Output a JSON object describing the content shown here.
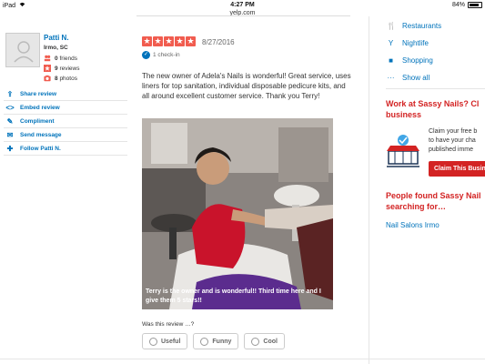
{
  "status_bar": {
    "device": "iPad",
    "time": "4:27 PM",
    "url": "yelp.com",
    "battery": "84%",
    "battery_level": 0.84
  },
  "user": {
    "name": "Patti N.",
    "location": "Irmo, SC",
    "friends": "0",
    "friends_label": "friends",
    "reviews": "9",
    "reviews_label": "reviews",
    "photos": "8",
    "photos_label": "photos"
  },
  "actions": [
    {
      "label": "Share review",
      "icon": "share-icon"
    },
    {
      "label": "Embed review",
      "icon": "code-icon"
    },
    {
      "label": "Compliment",
      "icon": "compliment-icon"
    },
    {
      "label": "Send message",
      "icon": "message-icon"
    },
    {
      "label": "Follow Patti N.",
      "icon": "follow-icon"
    }
  ],
  "review": {
    "rating": 5,
    "date": "8/27/2016",
    "checkin": "1 check-in",
    "text": "The new owner of Adela's Nails is wonderful! Great service, uses liners for top sanitation, individual disposable pedicure kits, and all around excellent customer service. Thank you Terry!",
    "photo_caption": "Terry is the owner and is wonderful!! Third time here and I give them 5 stars!!",
    "was_this": "Was this review …?",
    "votes": [
      {
        "label": "Useful",
        "icon": "useful-icon"
      },
      {
        "label": "Funny",
        "icon": "funny-icon"
      },
      {
        "label": "Cool",
        "icon": "cool-icon"
      }
    ]
  },
  "sidebar": {
    "links": [
      {
        "label": "Restaurants",
        "icon": "fork-knife-icon"
      },
      {
        "label": "Nightlife",
        "icon": "cocktail-icon"
      },
      {
        "label": "Shopping",
        "icon": "shopping-bag-icon"
      },
      {
        "label": "Show all",
        "icon": "more-icon"
      }
    ],
    "work_heading_1": "Work at Sassy Nails? Cl",
    "work_heading_2": "business",
    "claim_text_1": "Claim your free b",
    "claim_text_2": "to have your cha",
    "claim_text_3": "published imme",
    "claim_button": "Claim This Busin",
    "people_heading_1": "People found Sassy Nail",
    "people_heading_2": "searching for…",
    "nail_link": "Nail Salons Irmo"
  },
  "colors": {
    "yelp_red": "#d32323",
    "star_red": "#f15c4f",
    "link_blue": "#0073bb"
  }
}
